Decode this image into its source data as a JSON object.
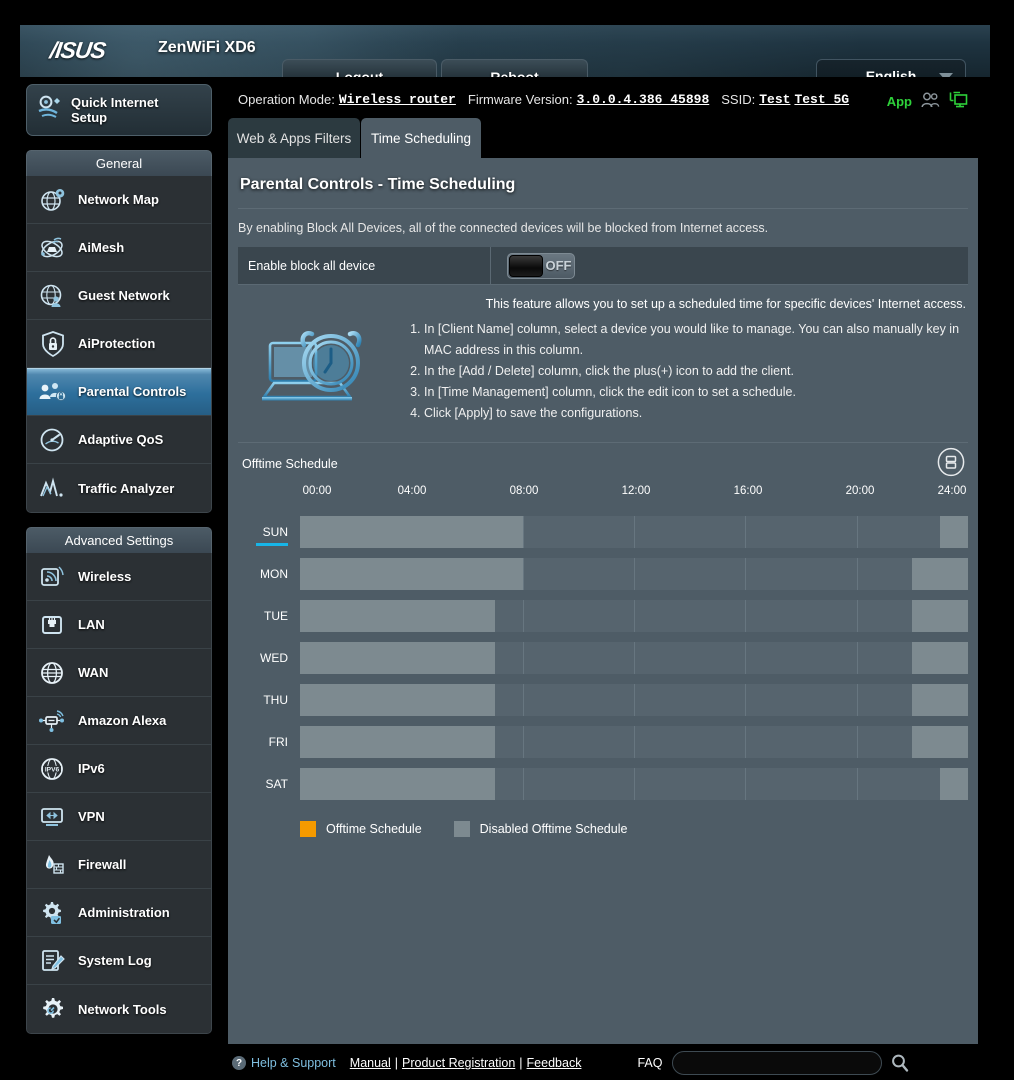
{
  "header": {
    "brand": "/ISUS",
    "model": "ZenWiFi XD6",
    "logout_label": "Logout",
    "reboot_label": "Reboot",
    "language": "English"
  },
  "infobar": {
    "operation_mode_label": "Operation Mode:",
    "operation_mode_value": "Wireless router",
    "firmware_label": "Firmware Version:",
    "firmware_value": "3.0.0.4.386_45898",
    "ssid_label": "SSID:",
    "ssid_1": "Test",
    "ssid_2": "Test_5G",
    "app_label": "App"
  },
  "sidebar": {
    "quick_setup_label": "Quick Internet Setup",
    "general_header": "General",
    "advanced_header": "Advanced Settings",
    "general_items": [
      {
        "label": "Network Map",
        "icon": "network-map-icon",
        "active": false
      },
      {
        "label": "AiMesh",
        "icon": "aimesh-icon",
        "active": false
      },
      {
        "label": "Guest Network",
        "icon": "guest-network-icon",
        "active": false
      },
      {
        "label": "AiProtection",
        "icon": "shield-lock-icon",
        "active": false
      },
      {
        "label": "Parental Controls",
        "icon": "parental-controls-icon",
        "active": true
      },
      {
        "label": "Adaptive QoS",
        "icon": "speedometer-icon",
        "active": false
      },
      {
        "label": "Traffic Analyzer",
        "icon": "traffic-analyzer-icon",
        "active": false
      }
    ],
    "advanced_items": [
      {
        "label": "Wireless",
        "icon": "wireless-icon"
      },
      {
        "label": "LAN",
        "icon": "lan-port-icon"
      },
      {
        "label": "WAN",
        "icon": "globe-icon"
      },
      {
        "label": "Amazon Alexa",
        "icon": "alexa-icon"
      },
      {
        "label": "IPv6",
        "icon": "ipv6-icon"
      },
      {
        "label": "VPN",
        "icon": "vpn-icon"
      },
      {
        "label": "Firewall",
        "icon": "firewall-flame-icon"
      },
      {
        "label": "Administration",
        "icon": "gear-admin-icon"
      },
      {
        "label": "System Log",
        "icon": "system-log-icon"
      },
      {
        "label": "Network Tools",
        "icon": "network-tools-icon"
      }
    ]
  },
  "tabs": [
    {
      "label": "Web & Apps Filters",
      "active": false
    },
    {
      "label": "Time Scheduling",
      "active": true
    }
  ],
  "main": {
    "page_title": "Parental Controls - Time Scheduling",
    "description": "By enabling Block All Devices, all of the connected devices will be blocked from Internet access.",
    "block_all_label": "Enable block all device",
    "block_all_state": "OFF",
    "feature_note": "This feature allows you to set up a scheduled time for specific devices' Internet access.",
    "steps": [
      "In [Client Name] column, select a device you would like to manage. You can also manually key in MAC address in this column.",
      "In the [Add / Delete] column, click the plus(+) icon to add the client.",
      "In [Time Management] column, click the edit icon to set a schedule.",
      "Click [Apply] to save the configurations."
    ],
    "schedule_title": "Offtime Schedule",
    "legend": [
      {
        "label": "Offtime Schedule",
        "color": "#f59a00"
      },
      {
        "label": "Disabled Offtime Schedule",
        "color": "#7d8a90"
      }
    ]
  },
  "chart_data": {
    "type": "heatmap",
    "title": "Offtime Schedule",
    "xlabel": "",
    "ylabel": "",
    "time_ticks": [
      "00:00",
      "04:00",
      "08:00",
      "12:00",
      "16:00",
      "20:00",
      "24:00"
    ],
    "xlim": [
      0,
      24
    ],
    "grid": true,
    "legend_position": "bottom-left",
    "days": [
      "SUN",
      "MON",
      "TUE",
      "WED",
      "THU",
      "FRI",
      "SAT"
    ],
    "selected_day": "SUN",
    "state_colors": {
      "enabled": "#f59a00",
      "disabled": "#7d8a90",
      "empty": "#56646e"
    },
    "rows": [
      {
        "day": "SUN",
        "blocks": [
          {
            "start": 0,
            "end": 8,
            "state": "disabled"
          },
          {
            "start": 23,
            "end": 24,
            "state": "disabled"
          }
        ]
      },
      {
        "day": "MON",
        "blocks": [
          {
            "start": 0,
            "end": 8,
            "state": "disabled"
          },
          {
            "start": 22,
            "end": 24,
            "state": "disabled"
          }
        ]
      },
      {
        "day": "TUE",
        "blocks": [
          {
            "start": 0,
            "end": 7,
            "state": "disabled"
          },
          {
            "start": 22,
            "end": 24,
            "state": "disabled"
          }
        ]
      },
      {
        "day": "WED",
        "blocks": [
          {
            "start": 0,
            "end": 7,
            "state": "disabled"
          },
          {
            "start": 22,
            "end": 24,
            "state": "disabled"
          }
        ]
      },
      {
        "day": "THU",
        "blocks": [
          {
            "start": 0,
            "end": 7,
            "state": "disabled"
          },
          {
            "start": 22,
            "end": 24,
            "state": "disabled"
          }
        ]
      },
      {
        "day": "FRI",
        "blocks": [
          {
            "start": 0,
            "end": 7,
            "state": "disabled"
          },
          {
            "start": 22,
            "end": 24,
            "state": "disabled"
          }
        ]
      },
      {
        "day": "SAT",
        "blocks": [
          {
            "start": 0,
            "end": 7,
            "state": "disabled"
          },
          {
            "start": 23,
            "end": 24,
            "state": "disabled"
          }
        ]
      }
    ]
  },
  "footer": {
    "help_label": "Help & Support",
    "manual_label": "Manual",
    "product_registration_label": "Product Registration",
    "feedback_label": "Feedback",
    "separator": "|",
    "faq_label": "FAQ",
    "faq_placeholder": ""
  }
}
